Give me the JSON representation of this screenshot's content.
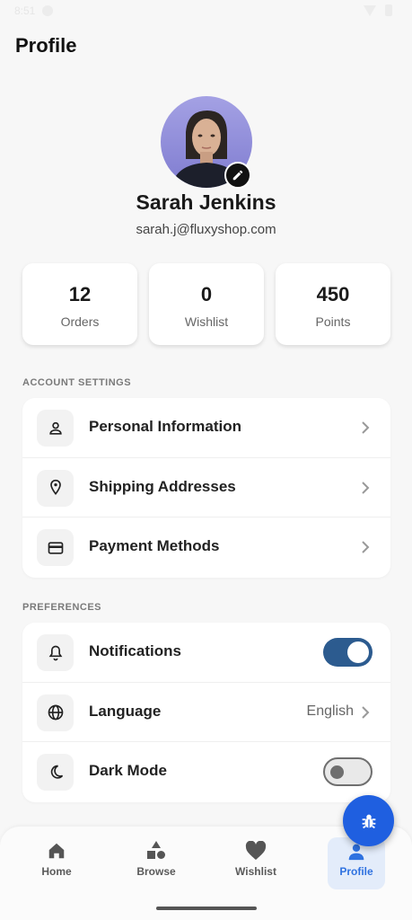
{
  "status_bar": {
    "time": "8:51"
  },
  "header": {
    "title": "Profile"
  },
  "user": {
    "name": "Sarah Jenkins",
    "email": "sarah.j@fluxyshop.com"
  },
  "stats": [
    {
      "value": "12",
      "label": "Orders"
    },
    {
      "value": "0",
      "label": "Wishlist"
    },
    {
      "value": "450",
      "label": "Points"
    }
  ],
  "account_settings": {
    "label": "ACCOUNT SETTINGS",
    "items": [
      {
        "label": "Personal Information",
        "icon": "person-icon"
      },
      {
        "label": "Shipping Addresses",
        "icon": "location-pin-icon"
      },
      {
        "label": "Payment Methods",
        "icon": "credit-card-icon"
      }
    ]
  },
  "preferences": {
    "label": "PREFERENCES",
    "items": [
      {
        "label": "Notifications",
        "icon": "bell-icon",
        "toggle": true
      },
      {
        "label": "Language",
        "icon": "globe-icon",
        "value": "English"
      },
      {
        "label": "Dark Mode",
        "icon": "moon-icon",
        "toggle": false
      }
    ]
  },
  "bottom_nav": {
    "items": [
      {
        "label": "Home",
        "icon": "home-icon"
      },
      {
        "label": "Browse",
        "icon": "shapes-icon"
      },
      {
        "label": "Wishlist",
        "icon": "heart-icon"
      },
      {
        "label": "Profile",
        "icon": "person-icon",
        "active": true
      }
    ]
  },
  "colors": {
    "accent": "#2f72e0",
    "toggle_on": "#2c5b8f",
    "fab": "#1f5fe0",
    "background": "#f7f7f7"
  }
}
